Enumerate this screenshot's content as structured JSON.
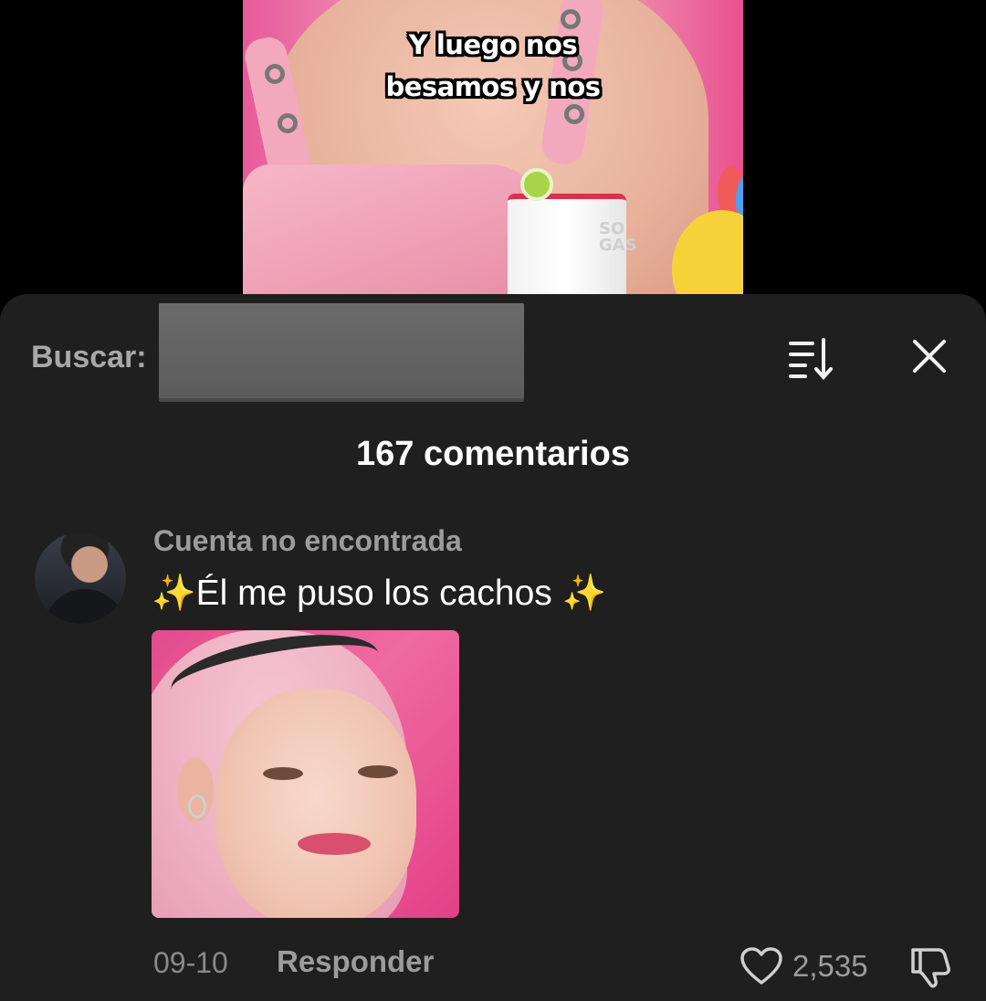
{
  "video": {
    "caption_line1": "Y luego nos",
    "caption_line2": "besamos y nos"
  },
  "search": {
    "label": "Buscar:",
    "value": ""
  },
  "header": {
    "sort_icon": "sort-icon",
    "close_icon": "close-icon"
  },
  "comments": {
    "count_label": "167 comentarios",
    "items": [
      {
        "username": "Cuenta no encontrada",
        "text_prefix": "✨",
        "text_body": "Él me puso los cachos ",
        "text_suffix": "✨",
        "date": "09-10",
        "reply_label": "Responder",
        "likes": "2,535"
      }
    ]
  },
  "colors": {
    "sheet_bg": "#1f1f1f",
    "muted_text": "#9c9c9c",
    "sparkle": "#ffd54a"
  }
}
